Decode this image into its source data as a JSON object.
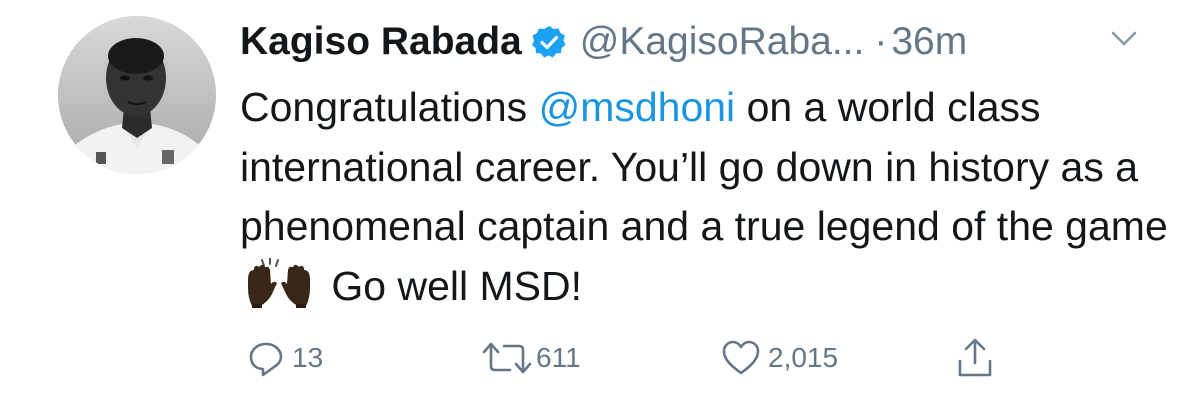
{
  "tweet": {
    "display_name": "Kagiso Rabada",
    "handle": "@KagisoRaba...",
    "separator": "·",
    "time": "36m",
    "verified": true,
    "text": {
      "part1": "Congratulations ",
      "mention": "@msdhoni",
      "part2": " on a world class international career. You’ll go down in history as a phenomenal captain and a true legend of the game",
      "emoji": "raising-hands-emoji",
      "part3": " Go well MSD!"
    },
    "actions": {
      "reply_count": "13",
      "retweet_count": "611",
      "like_count": "2,015"
    }
  },
  "colors": {
    "text": "#14171a",
    "secondary": "#657786",
    "link": "#1b95e0",
    "verified": "#1da1f2"
  },
  "icons": [
    "verified-badge-icon",
    "chevron-down-icon",
    "reply-icon",
    "retweet-icon",
    "like-icon",
    "share-icon"
  ]
}
